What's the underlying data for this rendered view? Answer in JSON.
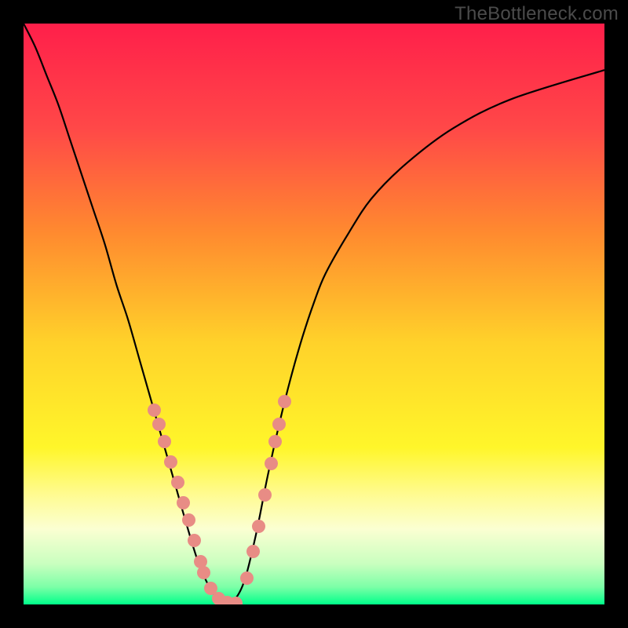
{
  "watermark": "TheBottleneck.com",
  "colors": {
    "frame_bg": "#000000",
    "marker": "#e88c85",
    "curve": "#000000"
  },
  "chart_data": {
    "type": "line",
    "title": "",
    "xlabel": "",
    "ylabel": "",
    "xlim": [
      0,
      100
    ],
    "ylim": [
      0,
      100
    ],
    "grid": false,
    "legend": false,
    "background_gradient_stops": [
      {
        "offset": 0.0,
        "color": "#ff1f4a"
      },
      {
        "offset": 0.18,
        "color": "#ff4848"
      },
      {
        "offset": 0.36,
        "color": "#ff8a2f"
      },
      {
        "offset": 0.55,
        "color": "#ffd22a"
      },
      {
        "offset": 0.73,
        "color": "#fff62a"
      },
      {
        "offset": 0.81,
        "color": "#fffb90"
      },
      {
        "offset": 0.87,
        "color": "#fbffd2"
      },
      {
        "offset": 0.93,
        "color": "#c9ffbf"
      },
      {
        "offset": 0.97,
        "color": "#7cffa7"
      },
      {
        "offset": 1.0,
        "color": "#00ff8a"
      }
    ],
    "series": [
      {
        "name": "valley-curve",
        "type": "line",
        "x": [
          0,
          2,
          4,
          6,
          8,
          10,
          12,
          14,
          16,
          18,
          20,
          22,
          24,
          26,
          28,
          30,
          32,
          34,
          36,
          38,
          40,
          42,
          44,
          46,
          48,
          50,
          52,
          56,
          60,
          66,
          74,
          84,
          100
        ],
        "y": [
          100,
          96,
          91,
          86,
          80,
          74,
          68,
          62,
          55,
          49,
          42,
          35,
          28,
          21,
          14,
          7.5,
          3,
          0.5,
          0.5,
          4,
          12,
          22,
          31,
          39,
          46,
          52,
          57,
          64,
          70,
          76,
          82,
          87,
          92
        ]
      },
      {
        "name": "overlay-markers",
        "type": "scatter",
        "x": [
          22.5,
          23.3,
          24.3,
          25.4,
          26.5,
          27.5,
          28.4,
          29.4,
          30.5,
          31.0,
          32.2,
          33.6,
          35.0,
          36.5,
          38.5,
          39.5,
          40.5,
          41.5,
          42.6,
          43.3,
          44.0,
          44.9
        ],
        "y": [
          33.5,
          31.0,
          28.0,
          24.5,
          21.0,
          17.5,
          14.5,
          11.0,
          7.3,
          5.5,
          2.8,
          1.0,
          0.3,
          0.2,
          4.5,
          9.1,
          13.5,
          18.8,
          24.2,
          28.0,
          31.0,
          35.0
        ]
      }
    ]
  }
}
